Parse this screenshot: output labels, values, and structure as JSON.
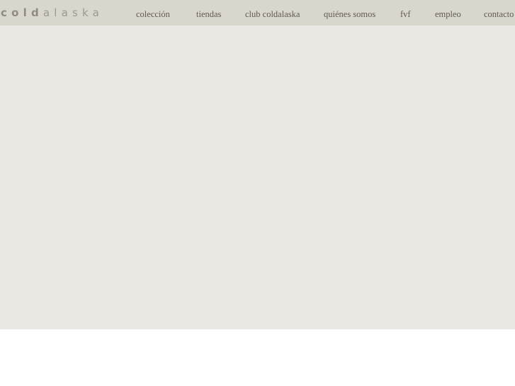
{
  "logo": {
    "bold": "cold",
    "light": "alaska"
  },
  "nav": [
    {
      "label": "colección"
    },
    {
      "label": "tiendas"
    },
    {
      "label": "club coldalaska"
    },
    {
      "label": "quiénes somos"
    },
    {
      "label": "fvf"
    },
    {
      "label": "empleo"
    },
    {
      "label": "contacto"
    }
  ],
  "colors": {
    "topbar": "#d9d6cb",
    "hero": "#eae8e3",
    "nav_text": "#5f5a50",
    "logo_text": "#8f8b80"
  }
}
